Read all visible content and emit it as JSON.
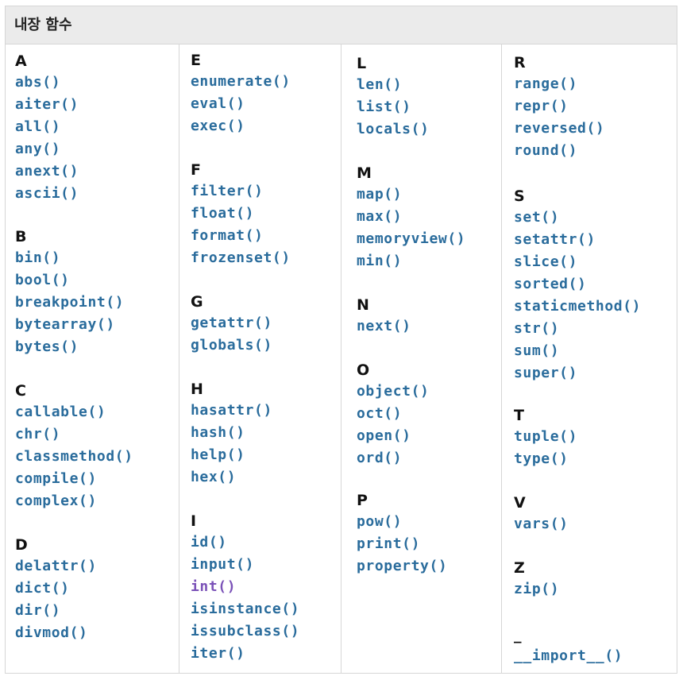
{
  "header": {
    "title": "내장 함수"
  },
  "columns": [
    {
      "groups": [
        {
          "letter": "A",
          "items": [
            {
              "name": "abs()"
            },
            {
              "name": "aiter()"
            },
            {
              "name": "all()"
            },
            {
              "name": "any()"
            },
            {
              "name": "anext()"
            },
            {
              "name": "ascii()"
            }
          ]
        },
        {
          "letter": "B",
          "items": [
            {
              "name": "bin()"
            },
            {
              "name": "bool()"
            },
            {
              "name": "breakpoint()"
            },
            {
              "name": "bytearray()"
            },
            {
              "name": "bytes()"
            }
          ]
        },
        {
          "letter": "C",
          "items": [
            {
              "name": "callable()"
            },
            {
              "name": "chr()"
            },
            {
              "name": "classmethod()"
            },
            {
              "name": "compile()"
            },
            {
              "name": "complex()"
            }
          ]
        },
        {
          "letter": "D",
          "items": [
            {
              "name": "delattr()"
            },
            {
              "name": "dict()"
            },
            {
              "name": "dir()"
            },
            {
              "name": "divmod()"
            }
          ]
        }
      ]
    },
    {
      "groups": [
        {
          "letter": "E",
          "items": [
            {
              "name": "enumerate()"
            },
            {
              "name": "eval()"
            },
            {
              "name": "exec()"
            }
          ]
        },
        {
          "letter": "F",
          "items": [
            {
              "name": "filter()"
            },
            {
              "name": "float()"
            },
            {
              "name": "format()"
            },
            {
              "name": "frozenset()"
            }
          ]
        },
        {
          "letter": "G",
          "items": [
            {
              "name": "getattr()"
            },
            {
              "name": "globals()"
            }
          ]
        },
        {
          "letter": "H",
          "items": [
            {
              "name": "hasattr()"
            },
            {
              "name": "hash()"
            },
            {
              "name": "help()"
            },
            {
              "name": "hex()"
            }
          ]
        },
        {
          "letter": "I",
          "items": [
            {
              "name": "id()"
            },
            {
              "name": "input()"
            },
            {
              "name": "int()",
              "visited": true
            },
            {
              "name": "isinstance()"
            },
            {
              "name": "issubclass()"
            },
            {
              "name": "iter()"
            }
          ]
        }
      ]
    },
    {
      "groups": [
        {
          "letter": "L",
          "items": [
            {
              "name": "len()"
            },
            {
              "name": "list()"
            },
            {
              "name": "locals()"
            }
          ]
        },
        {
          "letter": "M",
          "items": [
            {
              "name": "map()"
            },
            {
              "name": "max()"
            },
            {
              "name": "memoryview()"
            },
            {
              "name": "min()"
            }
          ]
        },
        {
          "letter": "N",
          "items": [
            {
              "name": "next()"
            }
          ]
        },
        {
          "letter": "O",
          "items": [
            {
              "name": "object()"
            },
            {
              "name": "oct()"
            },
            {
              "name": "open()"
            },
            {
              "name": "ord()"
            }
          ]
        },
        {
          "letter": "P",
          "items": [
            {
              "name": "pow()"
            },
            {
              "name": "print()"
            },
            {
              "name": "property()"
            }
          ]
        }
      ]
    },
    {
      "groups": [
        {
          "letter": "R",
          "items": [
            {
              "name": "range()"
            },
            {
              "name": "repr()"
            },
            {
              "name": "reversed()"
            },
            {
              "name": "round()"
            }
          ]
        },
        {
          "letter": "S",
          "items": [
            {
              "name": "set()"
            },
            {
              "name": "setattr()"
            },
            {
              "name": "slice()"
            },
            {
              "name": "sorted()"
            },
            {
              "name": "staticmethod()"
            },
            {
              "name": "str()"
            },
            {
              "name": "sum()"
            },
            {
              "name": "super()"
            }
          ]
        },
        {
          "letter": "T",
          "items": [
            {
              "name": "tuple()"
            },
            {
              "name": "type()"
            }
          ]
        },
        {
          "letter": "V",
          "items": [
            {
              "name": "vars()"
            }
          ]
        },
        {
          "letter": "Z",
          "items": [
            {
              "name": "zip()"
            }
          ]
        },
        {
          "letter": "_",
          "items": [
            {
              "name": "__import__()"
            }
          ]
        }
      ]
    }
  ]
}
